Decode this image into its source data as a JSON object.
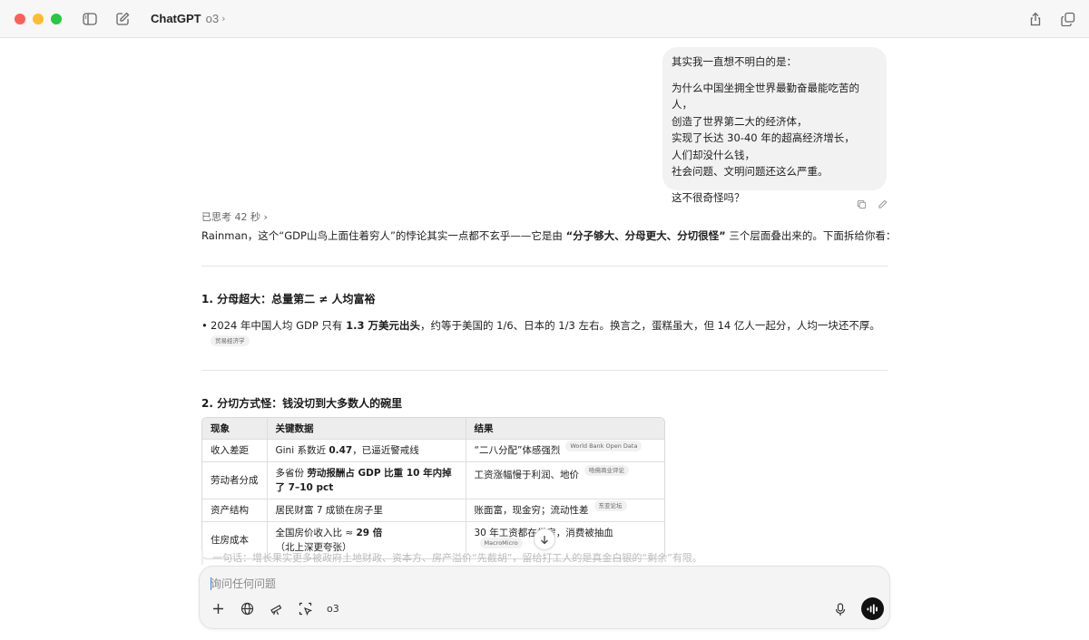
{
  "window": {
    "app_title": "ChatGPT",
    "model": "o3"
  },
  "user_message": {
    "lines": [
      "其实我一直想不明白的是：",
      "为什么中国坐拥全世界最勤奋最能吃苦的人，",
      "创造了世界第二大的经济体，",
      "实现了长达 30-40 年的超高经济增长，",
      "人们却没什么钱，",
      "社会问题、文明问题还这么严重。",
      "这不很奇怪吗？"
    ]
  },
  "assistant": {
    "thought_label": "已思考 42 秒",
    "intro": {
      "prefix": "Rainman，这个“GDP山鸟上面住着穷人”的悖论其实一点都不玄乎——它是由 ",
      "bold": "“分子够大、分母更大、分切很怪”",
      "suffix": " 三个层面叠出来的。下面拆给你看："
    },
    "section1": {
      "title": "1. 分母超大：总量第二 ≠ 人均富裕",
      "bullet_prefix": "2024 年中国人均 GDP 只有 ",
      "bullet_bold": "1.3 万美元出头",
      "bullet_suffix": "，约等于美国的 1/6、日本的 1/3 左右。换言之，蛋糕虽大，但 14 亿人一起分，人均一块还不厚。",
      "source": "贸易经济学"
    },
    "section2": {
      "title": "2. 分切方式怪：钱没切到大多数人的碗里",
      "table": {
        "headers": [
          "现象",
          "关键数据",
          "结果"
        ],
        "rows": [
          {
            "c1": "收入差距",
            "c2_pre": "Gini 系数近 ",
            "c2_bold": "0.47",
            "c2_post": "，已逼近警戒线",
            "c3": "“二八分配”体感强烈",
            "source": "World Bank Open Data"
          },
          {
            "c1": "劳动者分成",
            "c2_pre": "多省份 ",
            "c2_bold": "劳动报酬占 GDP 比重 10 年内掉了 7–10 pct",
            "c2_post": "",
            "c3": "工资涨幅慢于利润、地价",
            "source": "哈佛商业评论"
          },
          {
            "c1": "资产结构",
            "c2_pre": "居民财富 7 成锁在房子里",
            "c2_bold": "",
            "c2_post": "",
            "c3": "账面富，现金穷；流动性差",
            "source": "东亚论坛"
          },
          {
            "c1": "住房成本",
            "c2_pre": "全国房价收入比 ≈ ",
            "c2_bold": "29 倍",
            "c2_post": "（北上深更夸张）",
            "c3": "30 年工资都在供房，消费被抽血",
            "source": "MacroMicro"
          }
        ]
      }
    },
    "faded_line": "一句话：增长果实更多被政府土地财政、资本方、房产溢价“先截胡”，留给打工人的是真金白银的“剩余”有限。"
  },
  "composer": {
    "placeholder": "询问任何问题",
    "model_tag": "o3"
  },
  "icons": {
    "sidebar": "sidebar-toggle-icon",
    "new_chat": "compose-icon",
    "share": "share-icon",
    "new_window": "new-window-icon",
    "copy": "copy-icon",
    "edit": "pencil-icon",
    "plus": "plus-icon",
    "search": "globe-icon",
    "research": "telescope-icon",
    "tools": "cursor-select-icon",
    "mic": "mic-icon",
    "voice": "voice-mode-icon",
    "scroll": "arrow-down-icon"
  }
}
